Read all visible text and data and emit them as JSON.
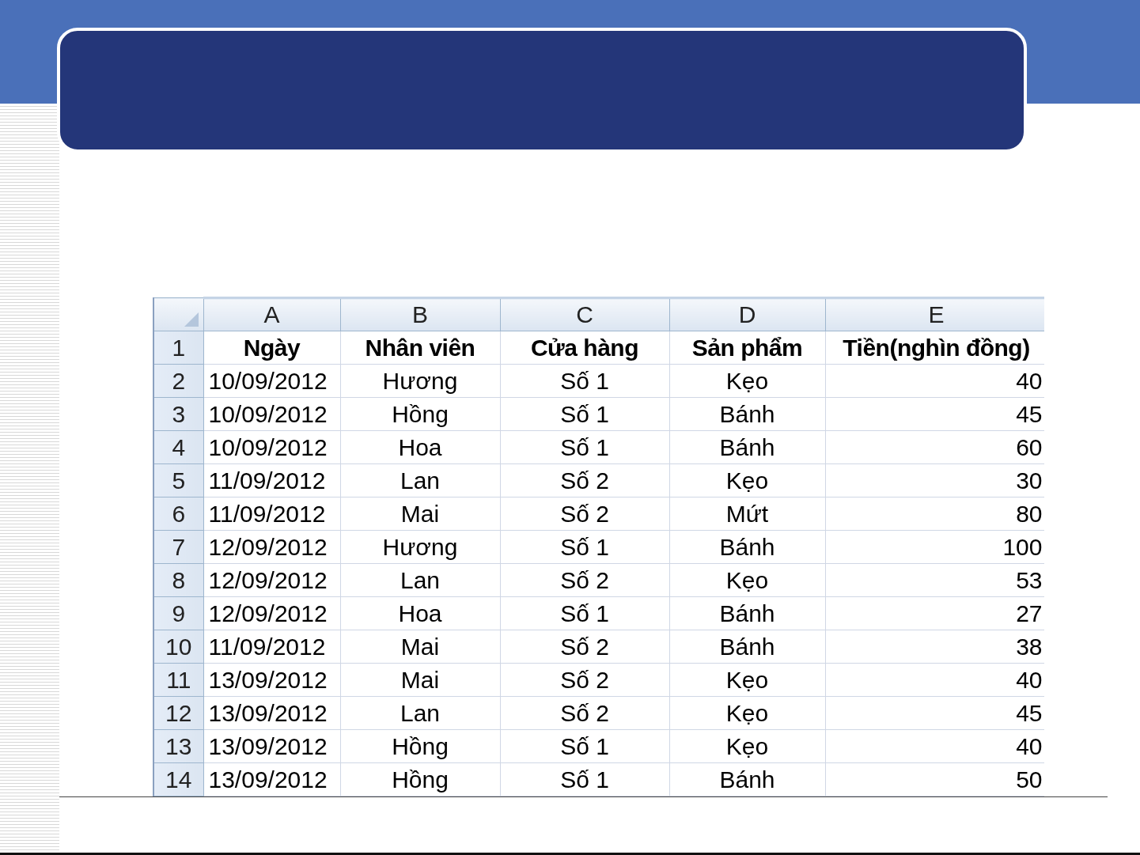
{
  "sheet": {
    "columns": [
      "A",
      "B",
      "C",
      "D",
      "E"
    ],
    "rows": [
      {
        "number": "1",
        "kind": "header",
        "cells": [
          "Ngày",
          "Nhân viên",
          "Cửa hàng",
          "Sản phẩm",
          "Tiền(nghìn đồng)"
        ]
      },
      {
        "number": "2",
        "kind": "data",
        "cells": [
          "10/09/2012",
          "Hương",
          "Số 1",
          "Kẹo",
          "40"
        ]
      },
      {
        "number": "3",
        "kind": "data",
        "cells": [
          "10/09/2012",
          "Hồng",
          "Số 1",
          "Bánh",
          "45"
        ]
      },
      {
        "number": "4",
        "kind": "data",
        "cells": [
          "10/09/2012",
          "Hoa",
          "Số 1",
          "Bánh",
          "60"
        ]
      },
      {
        "number": "5",
        "kind": "data",
        "cells": [
          "11/09/2012",
          "Lan",
          "Số 2",
          "Kẹo",
          "30"
        ]
      },
      {
        "number": "6",
        "kind": "data",
        "cells": [
          "11/09/2012",
          "Mai",
          "Số 2",
          "Mứt",
          "80"
        ]
      },
      {
        "number": "7",
        "kind": "data",
        "cells": [
          "12/09/2012",
          "Hương",
          "Số 1",
          "Bánh",
          "100"
        ]
      },
      {
        "number": "8",
        "kind": "data",
        "cells": [
          "12/09/2012",
          "Lan",
          "Số 2",
          "Kẹo",
          "53"
        ]
      },
      {
        "number": "9",
        "kind": "data",
        "cells": [
          "12/09/2012",
          "Hoa",
          "Số 1",
          "Bánh",
          "27"
        ]
      },
      {
        "number": "10",
        "kind": "data",
        "cells": [
          "11/09/2012",
          "Mai",
          "Số 2",
          "Bánh",
          "38"
        ]
      },
      {
        "number": "11",
        "kind": "data",
        "cells": [
          "13/09/2012",
          "Mai",
          "Số 2",
          "Kẹo",
          "40"
        ]
      },
      {
        "number": "12",
        "kind": "data",
        "cells": [
          "13/09/2012",
          "Lan",
          "Số 2",
          "Kẹo",
          "45"
        ]
      },
      {
        "number": "13",
        "kind": "data",
        "cells": [
          "13/09/2012",
          "Hồng",
          "Số 1",
          "Kẹo",
          "40"
        ]
      },
      {
        "number": "14",
        "kind": "data",
        "cells": [
          "13/09/2012",
          "Hồng",
          "Số 1",
          "Bánh",
          "50"
        ]
      }
    ]
  }
}
